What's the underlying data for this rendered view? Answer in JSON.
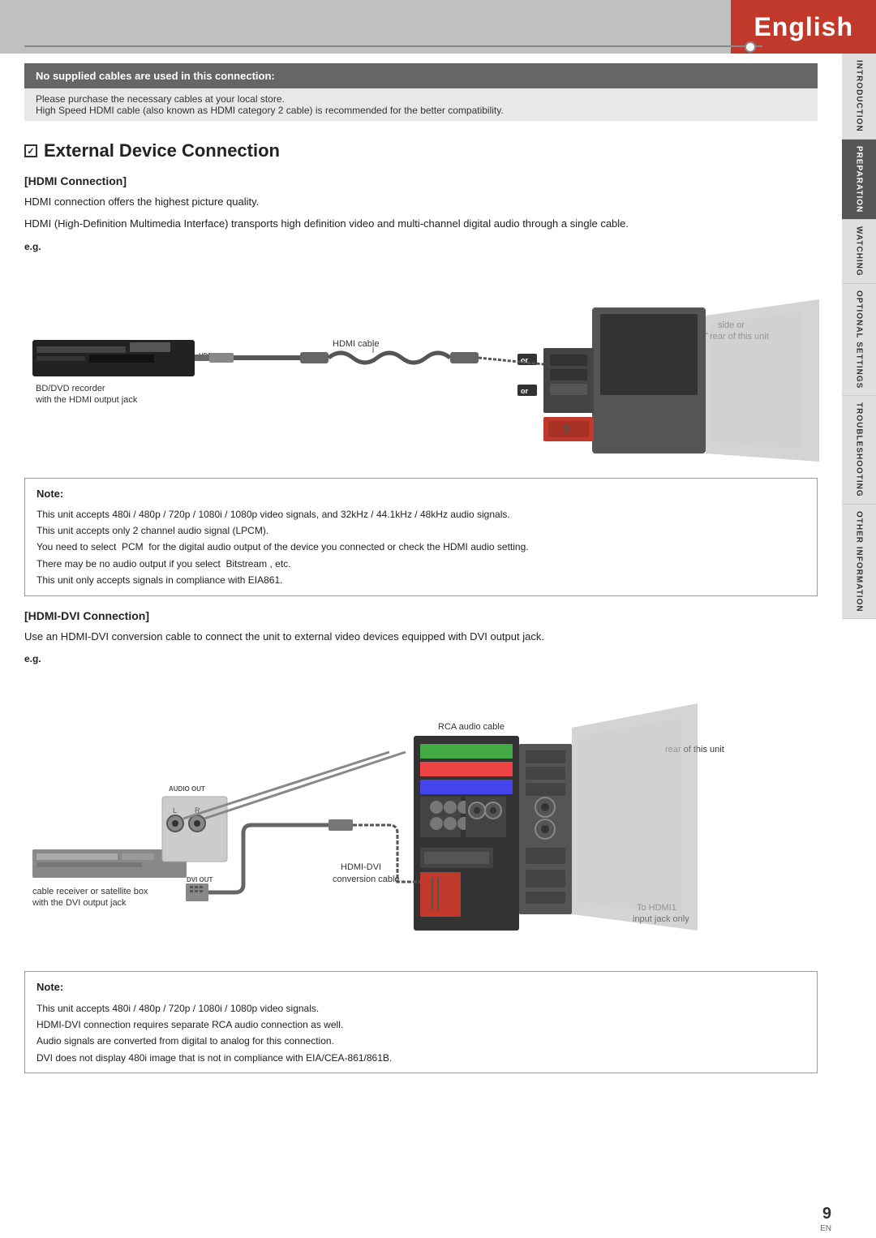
{
  "header": {
    "language": "English",
    "line_color": "#888"
  },
  "notice": {
    "dark_text": "No supplied cables are used in this connection:",
    "light_lines": [
      "Please purchase the necessary cables at your local store.",
      "High Speed HDMI cable (also known as HDMI category 2 cable) is recommended for the better compatibility."
    ]
  },
  "right_tabs": [
    {
      "label": "INTRODUCTION",
      "active": false
    },
    {
      "label": "PREPARATION",
      "active": true
    },
    {
      "label": "WATCHING",
      "active": false
    },
    {
      "label": "OPTIONAL SETTINGS",
      "active": false
    },
    {
      "label": "TROUBLESHOOTING",
      "active": false
    },
    {
      "label": "OTHER INFORMATION",
      "active": false
    }
  ],
  "section": {
    "checkbox": "5",
    "title": "External Device Connection"
  },
  "hdmi_connection": {
    "subsection": "HDMI Connection",
    "body1": "HDMI connection offers the highest picture quality.",
    "body2": "HDMI (High-Definition Multimedia Interface) transports high definition video and multi-channel digital audio through a single cable.",
    "eg": "e.g.",
    "labels": {
      "cable": "HDMI cable",
      "side_or_rear": "side or\nrear of this unit",
      "bd_dvd": "BD/DVD recorder\nwith the HDMI output jack",
      "hdm_out": "HDMI OUT",
      "or1": "or",
      "or2": "or"
    }
  },
  "hdmi_note": {
    "title": "Note:",
    "lines": [
      "This unit accepts 480i / 480p / 720p / 1080i / 1080p video signals, and 32kHz / 44.1kHz / 48kHz audio signals.",
      "This unit accepts only 2 channel audio signal (LPCM).",
      "You need to select  PCM  for the digital audio output of the device you connected or check the HDMI audio setting.",
      "There may be no audio output if you select  Bitstream , etc.",
      "This unit only accepts signals in compliance with EIA861."
    ]
  },
  "hdmi_dvi_connection": {
    "subsection": "HDMI-DVI Connection",
    "body": "Use an HDMI-DVI conversion cable to connect the unit to external video devices equipped with DVI output jack.",
    "eg": "e.g.",
    "labels": {
      "rca_audio": "RCA audio cable",
      "rear_of_unit": "rear of this unit",
      "hdmi_dvi_cable": "HDMI-DVI\nconversion cable",
      "cable_receiver": "cable receiver or satellite box\nwith the DVI output jack",
      "audio_out": "AUDIO OUT",
      "dvi_out": "DVI OUT",
      "to_hdmi1": "To HDMI1\ninput jack only"
    }
  },
  "hdmi_dvi_note": {
    "title": "Note:",
    "lines": [
      "This unit accepts 480i / 480p / 720p / 1080i / 1080p video signals.",
      "HDMI-DVI connection requires separate RCA audio connection as well.",
      "Audio signals are converted from digital to analog for this connection.",
      "DVI does not display 480i image that is not in compliance with EIA/CEA-861/861B."
    ]
  },
  "page_number": "9",
  "en_label": "EN"
}
